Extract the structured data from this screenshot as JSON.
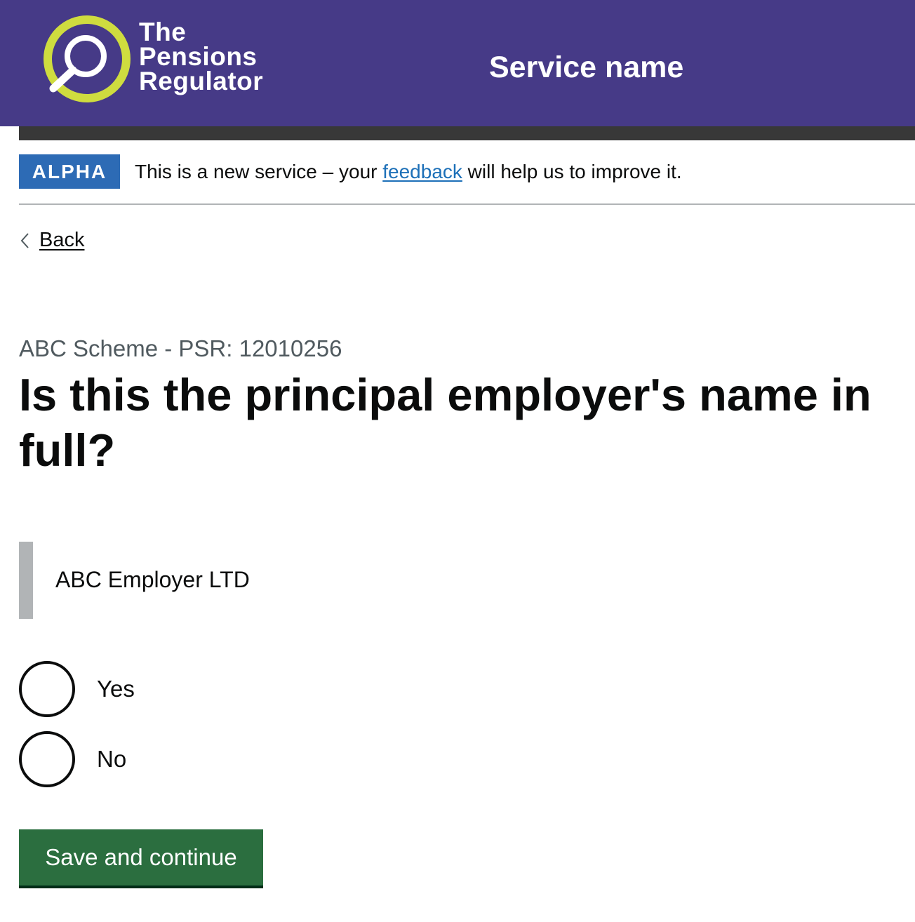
{
  "header": {
    "logo_lines": [
      "The",
      "Pensions",
      "Regulator"
    ],
    "service_name": "Service name"
  },
  "phase_banner": {
    "tag": "ALPHA",
    "text_before": "This is a new service – your ",
    "link_text": "feedback",
    "text_after": " will help us to improve it."
  },
  "back_link": {
    "label": "Back"
  },
  "main": {
    "caption": "ABC Scheme - PSR: 12010256",
    "heading": "Is this the principal employer's name in full?",
    "inset_text": "ABC Employer LTD"
  },
  "radios": {
    "options": [
      {
        "label": "Yes",
        "checked": false
      },
      {
        "label": "No",
        "checked": false
      }
    ]
  },
  "actions": {
    "submit_label": "Save and continue"
  },
  "colors": {
    "header_bg": "#463a87",
    "logo_ring": "#cfdc3f",
    "phase_tag_bg": "#2d6bb5",
    "link": "#1d70b8",
    "button_bg": "#2b6e3f",
    "inset_border": "#b1b4b6"
  }
}
